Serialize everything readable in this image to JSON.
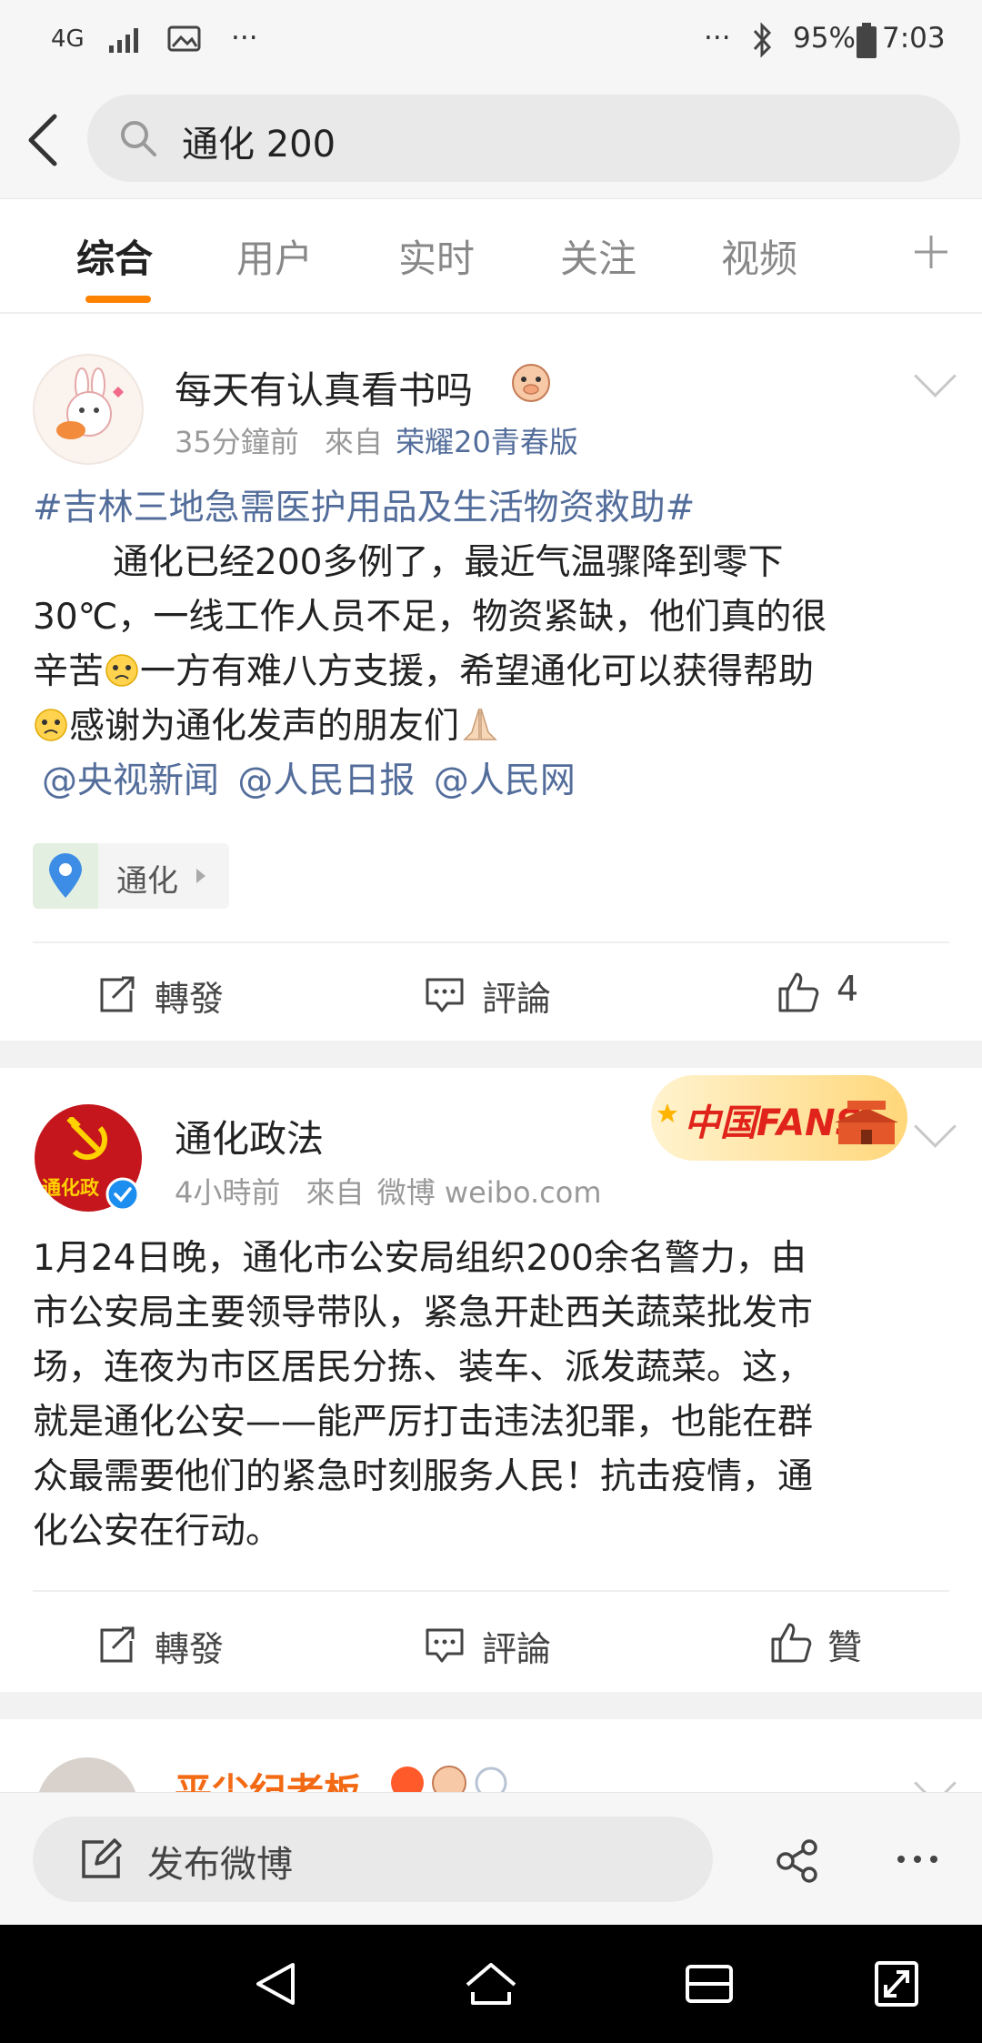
{
  "status_bar": {
    "network": "4G",
    "battery": "95%",
    "time": "7:03",
    "dots_left": "···",
    "dots_right": "···"
  },
  "search": {
    "query": "通化 200"
  },
  "tabs": [
    "综合",
    "用户",
    "实时",
    "关注",
    "视频"
  ],
  "post1": {
    "username": "每天有认真看书吗",
    "time": "35分鐘前",
    "from_label": "來自",
    "source": "荣耀20青春版",
    "topic": "#吉林三地急需医护用品及生活物资救助#",
    "line1": "通化已经200多例了，最近气温骤降到零下",
    "line2": "30℃，一线工作人员不足，物资紧缺，他们真的很",
    "line3a": "辛苦",
    "line3b": "一方有难八方支援，希望通化可以获得帮助",
    "line4": "感谢为通化发声的朋友们",
    "mention1": "@央视新闻",
    "mention2": "@人民日报",
    "mention3": "@人民网",
    "location": "通化",
    "repost": "轉發",
    "comment": "評論",
    "likes": "4"
  },
  "post2": {
    "username": "通化政法",
    "avatar_text": "通化政",
    "time": "4小時前",
    "from_label": "來自",
    "source": "微博 weibo.com",
    "badge": "中国FANS",
    "lines": [
      "1月24日晚，通化市公安局组织200余名警力，由",
      "市公安局主要领导带队，紧急开赴西关蔬菜批发市",
      "场，连夜为市区居民分拣、装车、派发蔬菜。这，",
      "就是通化公安——能严厉打击违法犯罪，也能在群",
      "众最需要他们的紧急时刻服务人民！抗击疫情，通",
      "化公安在行动。"
    ],
    "repost": "轉發",
    "comment": "評論",
    "like": "贊"
  },
  "post3": {
    "username": "平尘纪老板"
  },
  "bottom": {
    "compose_label": "发布微博"
  },
  "colors": {
    "accent": "#ff8200",
    "link": "#536d9b"
  }
}
